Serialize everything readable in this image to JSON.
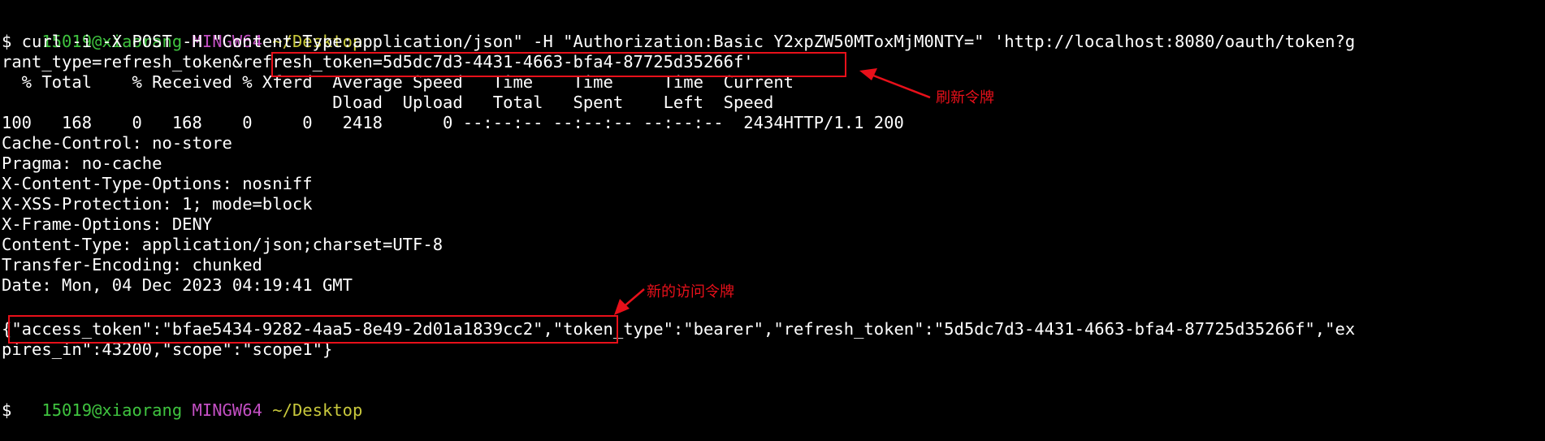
{
  "prompt1": {
    "user": "15019@xiaorang",
    "env": "MINGW64",
    "path": "~/Desktop"
  },
  "command_line1": "$ curl -i -X POST -H \"Content-Type:application/json\" -H \"Authorization:Basic Y2xpZW50MToxMjM0NTY=\" 'http://localhost:8080/oauth/token?g",
  "command_line2": "rant_type=refresh_token&refresh_token=5d5dc7d3-4431-4663-bfa4-87725d35266f'",
  "progress_header1": "  % Total    % Received % Xferd  Average Speed   Time    Time     Time  Current",
  "progress_header2": "                                 Dload  Upload   Total   Spent    Left  Speed",
  "progress_values": "100   168    0   168    0     0   2418      0 --:--:-- --:--:-- --:--:--  2434HTTP/1.1 200",
  "headers": [
    "Cache-Control: no-store",
    "Pragma: no-cache",
    "X-Content-Type-Options: nosniff",
    "X-XSS-Protection: 1; mode=block",
    "X-Frame-Options: DENY",
    "Content-Type: application/json;charset=UTF-8",
    "Transfer-Encoding: chunked",
    "Date: Mon, 04 Dec 2023 04:19:41 GMT"
  ],
  "body_line1": "{\"access_token\":\"bfae5434-9282-4aa5-8e49-2d01a1839cc2\",\"token_type\":\"bearer\",\"refresh_token\":\"5d5dc7d3-4431-4663-bfa4-87725d35266f\",\"ex",
  "body_line2": "pires_in\":43200,\"scope\":\"scope1\"}",
  "prompt2": {
    "user": "15019@xiaorang",
    "env": "MINGW64",
    "path": "~/Desktop"
  },
  "final_prompt": "$",
  "annotations": {
    "refresh_note": "刷新令牌",
    "access_note": "新的访问令牌"
  },
  "colors": {
    "background": "#000000",
    "text": "#ffffff",
    "prompt_user": "#3fc33f",
    "prompt_env": "#c34fc3",
    "prompt_path": "#c8c83c",
    "annotation": "#e8101a"
  }
}
